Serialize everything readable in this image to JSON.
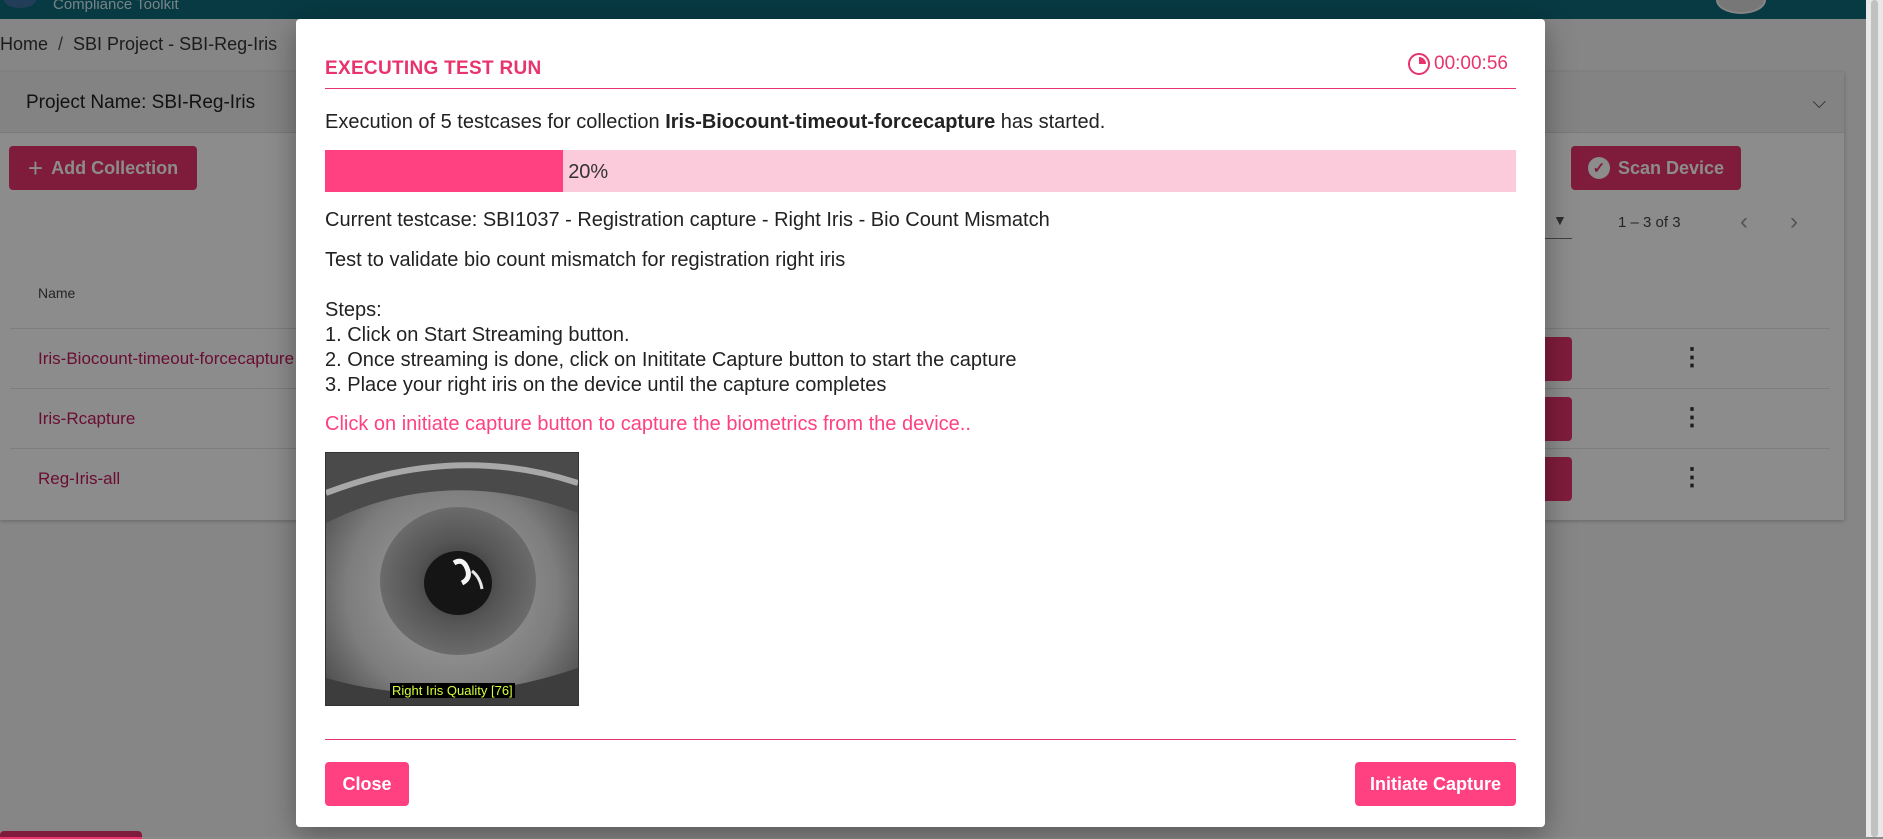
{
  "app": {
    "subtitle": "Compliance Toolkit"
  },
  "breadcrumb": {
    "home": "Home",
    "separator": "/",
    "current": "SBI Project - SBI-Reg-Iris"
  },
  "project": {
    "title": "Project Name: SBI-Reg-Iris"
  },
  "toolbar": {
    "add_collection": "Add Collection",
    "scan_device": "Scan Device"
  },
  "pager": {
    "range": "1 – 3 of 3"
  },
  "table": {
    "column_name": "Name",
    "rows": [
      {
        "name": "Iris-Biocount-timeout-forcecapture"
      },
      {
        "name": "Iris-Rcapture"
      },
      {
        "name": "Reg-Iris-all"
      }
    ]
  },
  "dialog": {
    "title": "EXECUTING TEST RUN",
    "timer": "00:00:56",
    "intro_prefix": "Execution of 5 testcases for collection ",
    "intro_collection": "Iris-Biocount-timeout-forcecapture",
    "intro_suffix": " has started.",
    "progress_label": "20%",
    "progress_fraction": 0.2,
    "current_testcase": "Current testcase: SBI1037 - Registration capture - Right Iris - Bio Count Mismatch",
    "description": "Test to validate bio count mismatch for registration right iris",
    "steps_heading": "Steps:",
    "steps": [
      "1. Click on Start Streaming button.",
      "2. Once streaming is done, click on Inititate Capture button to start the capture",
      "3. Place your right iris on the device until the capture completes"
    ],
    "hint": "Click on initiate capture button to capture the biometrics from the device..",
    "image_label": "Right Iris Quality [76]",
    "close_button": "Close",
    "initiate_button": "Initiate Capture"
  },
  "colors": {
    "accent": "#ff4081",
    "accent_dark": "#e8336d",
    "topbar": "#0e6b7a"
  }
}
